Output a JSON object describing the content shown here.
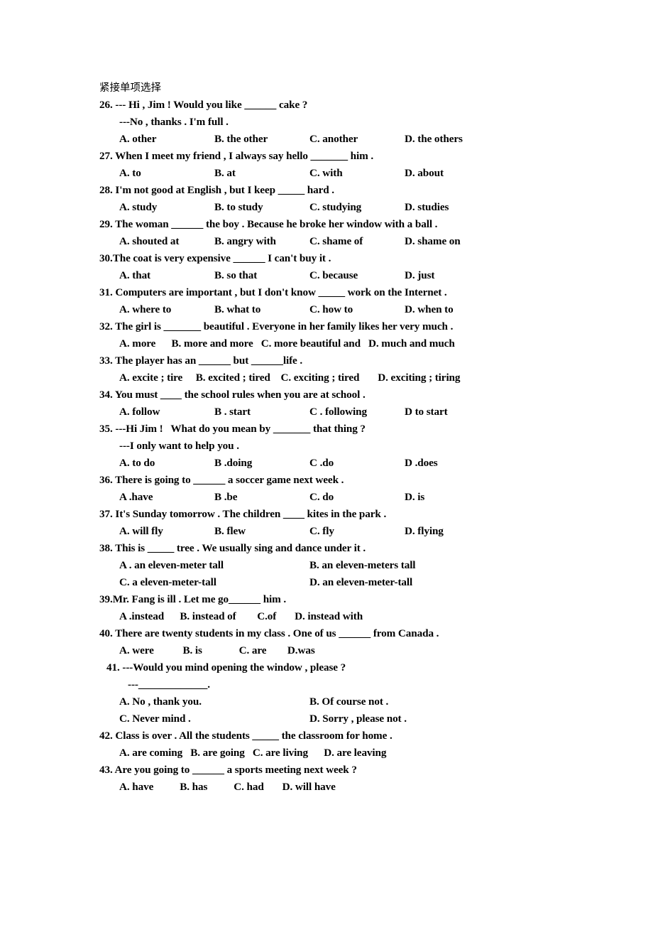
{
  "document": {
    "section_heading": "紧接单项选择",
    "questions": [
      {
        "number": "26.",
        "stem": "--- Hi , Jim ! Would you like ______ cake ?",
        "continuation": "---No , thanks . I'm full .",
        "layout": "cols4",
        "options": [
          "A. other",
          "B. the other",
          "C. another",
          "D. the others"
        ]
      },
      {
        "number": "27.",
        "stem": "When I meet my friend , I always say hello _______ him .",
        "layout": "cols4",
        "options": [
          "A. to",
          "B. at",
          "C. with",
          "D. about"
        ]
      },
      {
        "number": "28.",
        "stem": "I'm not good at English , but I keep _____ hard .",
        "layout": "cols4",
        "options": [
          "A. study",
          "B. to study",
          "C. studying",
          "D. studies"
        ]
      },
      {
        "number": "29.",
        "stem": "The woman ______ the boy . Because he broke her window with a ball .",
        "layout": "cols4",
        "options": [
          "A. shouted at",
          "B. angry with",
          "C. shame of",
          "D. shame on"
        ]
      },
      {
        "number": "30.",
        "stem": "The coat is very expensive ______ I can't buy it .",
        "no_space_after_number": true,
        "layout": "cols4",
        "options": [
          "A. that",
          "B. so that",
          "C. because",
          "D. just"
        ]
      },
      {
        "number": "31.",
        "stem": "Computers are important , but I don't know _____ work on the Internet .",
        "layout": "cols4",
        "options": [
          "A. where to",
          "B. what to",
          "C. how to",
          "D. when to"
        ]
      },
      {
        "number": "32.",
        "stem": "The girl is _______ beautiful . Everyone in her family likes her very much .",
        "layout": "flow",
        "options": [
          "A. more",
          "B. more and more",
          "C. more beautiful and",
          "D. much and much"
        ],
        "flow_gaps": [
          "      ",
          "   ",
          "   "
        ]
      },
      {
        "number": "33.",
        "stem": "The player has an ______ but ______life .",
        "layout": "flow",
        "options": [
          "A. excite ; tire",
          "B. excited ; tired",
          "C. exciting ; tired",
          "D. exciting ; tiring"
        ],
        "flow_gaps": [
          "     ",
          "    ",
          "       "
        ]
      },
      {
        "number": "34.",
        "stem": "You must ____ the school rules when you are at school .",
        "layout": "cols4",
        "options": [
          "A. follow",
          "B . start",
          "C . following",
          "D to start"
        ]
      },
      {
        "number": "35.",
        "stem": "---Hi Jim !   What do you mean by _______ that thing ?",
        "continuation": "---I only want to help you .",
        "layout": "cols4",
        "options": [
          "A. to do",
          "B .doing",
          "C .do",
          "D .does"
        ]
      },
      {
        "number": "36.",
        "stem": "There is going to ______ a soccer game next week .",
        "layout": "cols4",
        "options": [
          "A .have",
          "B .be",
          "C. do",
          "D. is"
        ]
      },
      {
        "number": "37.",
        "stem": "It's Sunday tomorrow . The children ____ kites in the park .",
        "layout": "cols4",
        "options": [
          "A. will fly",
          "B. flew",
          "C. fly",
          "D. flying"
        ]
      },
      {
        "number": "38.",
        "stem": "This is _____ tree . We usually sing and dance under it .",
        "layout": "cols2",
        "options": [
          "A . an eleven-meter tall",
          "B. an eleven-meters tall",
          "C. a eleven-meter-tall",
          "D. an eleven-meter-tall"
        ]
      },
      {
        "number": "39.",
        "stem": "Mr. Fang is ill . Let me go______ him .",
        "no_space_after_number": true,
        "layout": "flow",
        "options": [
          "A .instead",
          "B. instead of",
          "C.of",
          "D. instead with"
        ],
        "flow_gaps": [
          "      ",
          "        ",
          "       "
        ]
      },
      {
        "number": "40.",
        "stem": "There are twenty students in my class . One of us ______ from Canada .",
        "layout": "flow",
        "options": [
          "A. were",
          "B. is",
          "C. are",
          "D.was"
        ],
        "flow_gaps": [
          "           ",
          "              ",
          "        "
        ]
      },
      {
        "number": "41.",
        "stem": "---Would you mind opening the window , please ?",
        "continuation": "---_____________.",
        "extra_indent": true,
        "layout": "cols2",
        "options": [
          "A. No , thank you.",
          "B. Of course not .",
          "C. Never mind .",
          "D. Sorry , please not ."
        ]
      },
      {
        "number": "42.",
        "stem": "Class is over . All the students _____ the classroom for home .",
        "layout": "flow",
        "options": [
          "A. are coming",
          "B. are going",
          "C. are living",
          "D. are leaving"
        ],
        "flow_gaps": [
          "   ",
          "   ",
          "      "
        ]
      },
      {
        "number": "43.",
        "stem": "Are you going to ______ a sports meeting next week ?",
        "layout": "flow",
        "options": [
          "A. have",
          "B. has",
          "C. had",
          "D. will have"
        ],
        "flow_gaps": [
          "          ",
          "          ",
          "       "
        ]
      }
    ]
  }
}
